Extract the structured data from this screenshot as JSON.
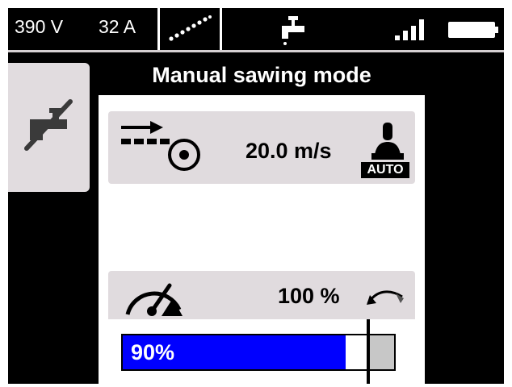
{
  "status_bar": {
    "voltage": "390 V",
    "current": "32 A",
    "icons": [
      "connection-dots-icon",
      "water-tap-icon",
      "signal-strength-icon",
      "battery-icon"
    ],
    "signal_bars": 4
  },
  "side_tab": {
    "icon": "water-off-icon"
  },
  "panel": {
    "title": "Manual sawing mode",
    "speed": {
      "icon": "feed-to-blade-icon",
      "value": "20.0 m/s",
      "mode_icon": "operator-auto-icon",
      "mode_label": "AUTO"
    },
    "power": {
      "icon": "gauge-icon",
      "value": "100 %",
      "adjust_icon": "adjust-arrows-icon",
      "bar_label": "90%",
      "bar_fill_percent": 90,
      "marker_percent": 100
    }
  },
  "colors": {
    "background": "#000000",
    "card": "#e0dbde",
    "bar_fill": "#0000ff",
    "bar_empty": "#c7c7c7",
    "text_light": "#ffffff"
  }
}
